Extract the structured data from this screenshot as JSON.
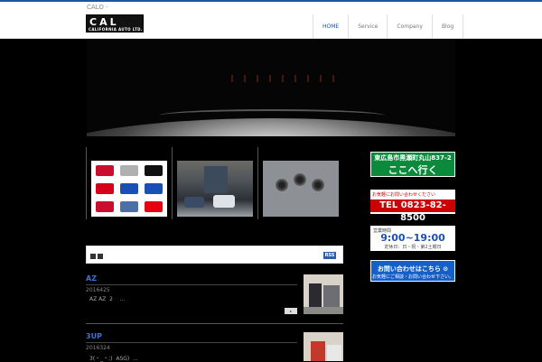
{
  "site": {
    "name": "CALO -"
  },
  "logo": {
    "mark": "CAL",
    "sub": "CALIFORNIA AUTO LTD."
  },
  "nav": {
    "items": [
      "HOME",
      "Service",
      "Company",
      "Blog"
    ],
    "active": "HOME"
  },
  "brand_colors": [
    "#c8102e",
    "#b0b0b0",
    "#101010",
    "#d4001a",
    "#1a4fb5",
    "#1a4fb5",
    "#c8102e",
    "#4d6fa8",
    "#e60012"
  ],
  "rss": {
    "label": "RSS"
  },
  "posts": [
    {
      "title": "AZ",
      "date": "2016425",
      "excerpt": "AZ AZ  2    ...",
      "more": "▸"
    },
    {
      "title": "3UP",
      "date": "2016324",
      "excerpt": "3(・_・;)  ASG)  ..."
    }
  ],
  "sidebar": {
    "map": {
      "address": "東広島市黒瀬町丸山837-2",
      "label": "ここへ行く"
    },
    "tel": {
      "caption": "お気軽にお問い合わせください",
      "number": "TEL 0823-82-8500"
    },
    "hours": {
      "caption": "営業時間",
      "time": "9:00~19:00",
      "closed": "定休日：日・祝・第2土曜日"
    },
    "contact": {
      "title": "お問い合わせはこちら ⊙",
      "sub": "お気軽にご相談・お問い合わせ下さい。"
    }
  },
  "colors": {
    "accent": "#1a55a8",
    "map_green": "#0b8a3c",
    "tel_red": "#cc0000",
    "contact_blue": "#1460c8",
    "post_title": "#3f73d6"
  }
}
